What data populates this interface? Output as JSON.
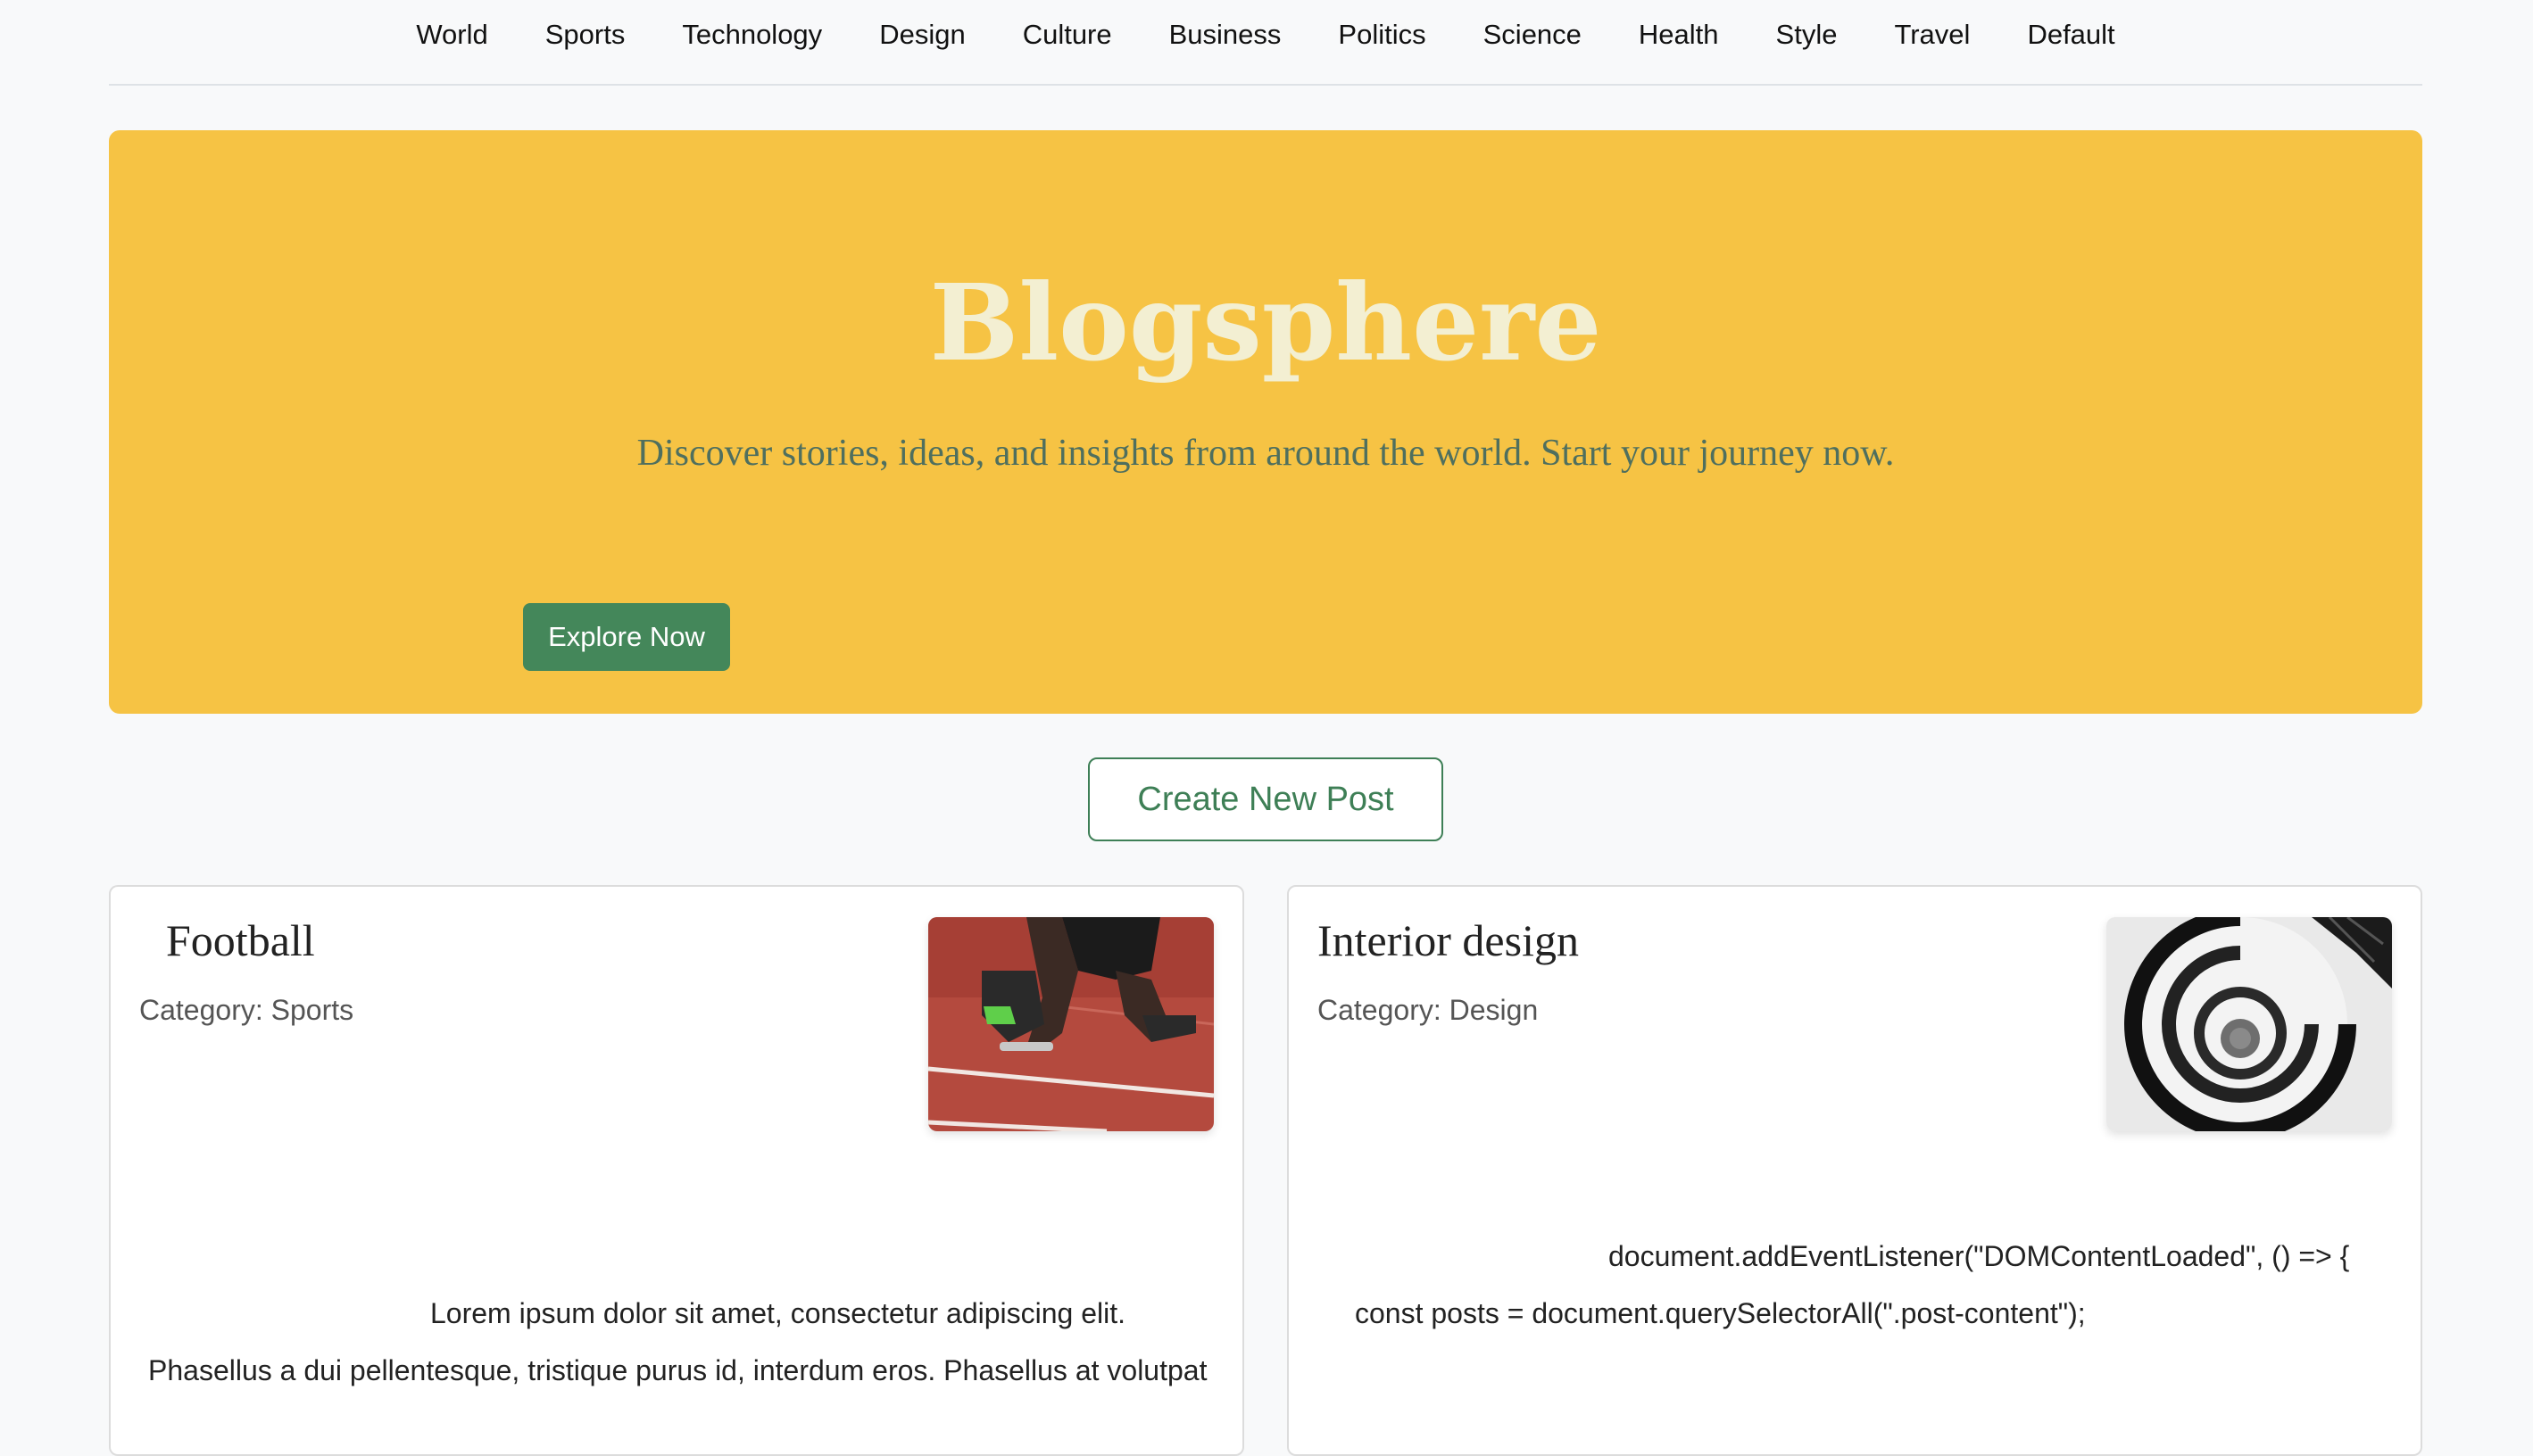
{
  "nav": {
    "items": [
      "World",
      "Sports",
      "Technology",
      "Design",
      "Culture",
      "Business",
      "Politics",
      "Science",
      "Health",
      "Style",
      "Travel",
      "Default"
    ]
  },
  "hero": {
    "title": "Blogsphere",
    "subtitle": "Discover stories, ideas, and insights from around the world. Start your journey now.",
    "button_label": "Explore Now"
  },
  "actions": {
    "create_label": "Create New Post"
  },
  "posts": [
    {
      "title": "Football",
      "category": "Category: Sports",
      "image_alt": "sprinter on running track",
      "lines": [
        "Lorem ipsum dolor sit amet, consectetur adipiscing elit.",
        "Phasellus a dui pellentesque, tristique purus id, interdum eros. Phasellus at volutpat"
      ]
    },
    {
      "title": "Interior design",
      "category": "Category: Design",
      "image_alt": "spiral staircase",
      "lines": [
        "document.addEventListener(\"DOMContentLoaded\", () => {",
        "const posts = document.querySelectorAll(\".post-content\");"
      ]
    }
  ]
}
